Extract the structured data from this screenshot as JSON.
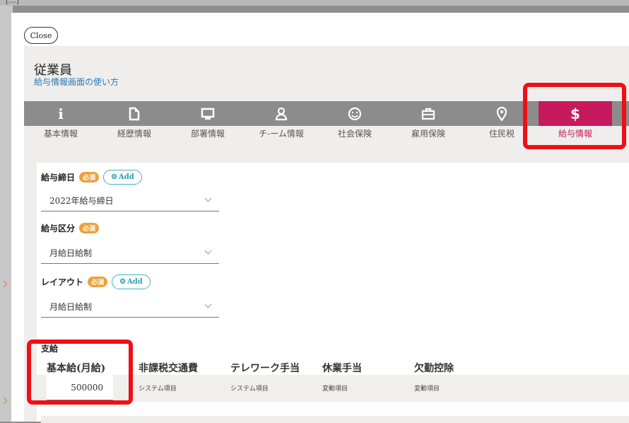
{
  "background": {
    "top_text": "[...]"
  },
  "close_label": "Close",
  "header": {
    "title": "従業員",
    "help_link": "給与情報画面の使い方"
  },
  "tabs": [
    {
      "label": "基本情報",
      "icon": "info-icon"
    },
    {
      "label": "経歴情報",
      "icon": "document-icon"
    },
    {
      "label": "部署情報",
      "icon": "monitor-icon"
    },
    {
      "label": "チ-ーム情報",
      "icon": "person-icon"
    },
    {
      "label": "社会保険",
      "icon": "smiley-icon"
    },
    {
      "label": "雇用保険",
      "icon": "briefcase-icon"
    },
    {
      "label": "住民税",
      "icon": "map-pin-icon"
    },
    {
      "label": "給与情報",
      "icon": "dollar-icon",
      "active": true
    }
  ],
  "form": {
    "pay_close": {
      "label": "給与締日",
      "required": "必須",
      "add": "Add",
      "value": "2022年給与締日"
    },
    "pay_class": {
      "label": "給与区分",
      "required": "必須",
      "value": "月給日給制"
    },
    "layout": {
      "label": "レイアウト",
      "required": "必須",
      "add": "Add",
      "value": "月給日給制"
    }
  },
  "payment": {
    "section": "支給",
    "headers": [
      "基本給(月給)",
      "非課税交通費",
      "テレワーク手当",
      "休業手当",
      "欠勤控除"
    ],
    "base_value": "500000",
    "cells": [
      "システム項目",
      "システム項目",
      "変動項目",
      "変動項目"
    ]
  },
  "colors": {
    "accent": "#c6195e",
    "highlight": "#ee0f17",
    "required": "#e9a23b",
    "add": "#3fb3c8",
    "link": "#2a7ab8"
  }
}
